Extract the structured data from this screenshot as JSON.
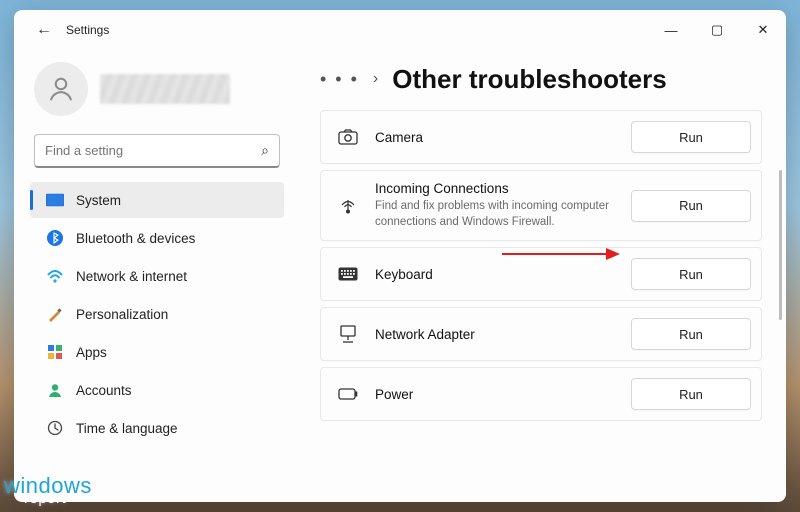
{
  "window": {
    "back_icon": "←",
    "title": "Settings",
    "controls": {
      "min": "—",
      "max": "▢",
      "close": "✕"
    }
  },
  "search": {
    "placeholder": "Find a setting",
    "icon": "⌕"
  },
  "sidebar": {
    "items": [
      {
        "label": "System"
      },
      {
        "label": "Bluetooth & devices"
      },
      {
        "label": "Network & internet"
      },
      {
        "label": "Personalization"
      },
      {
        "label": "Apps"
      },
      {
        "label": "Accounts"
      },
      {
        "label": "Time & language"
      }
    ]
  },
  "breadcrumb": {
    "dots": "• • •",
    "chevron": "›",
    "title": "Other troubleshooters"
  },
  "troubleshooters": [
    {
      "title": "Camera",
      "desc": "",
      "run": "Run"
    },
    {
      "title": "Incoming Connections",
      "desc": "Find and fix problems with incoming computer connections and Windows Firewall.",
      "run": "Run"
    },
    {
      "title": "Keyboard",
      "desc": "",
      "run": "Run"
    },
    {
      "title": "Network Adapter",
      "desc": "",
      "run": "Run"
    },
    {
      "title": "Power",
      "desc": "",
      "run": "Run"
    }
  ],
  "colors": {
    "accent": "#1f6cd1",
    "annotation": "#e11d1d"
  },
  "watermark": {
    "line1": "windows",
    "line2": "report"
  }
}
